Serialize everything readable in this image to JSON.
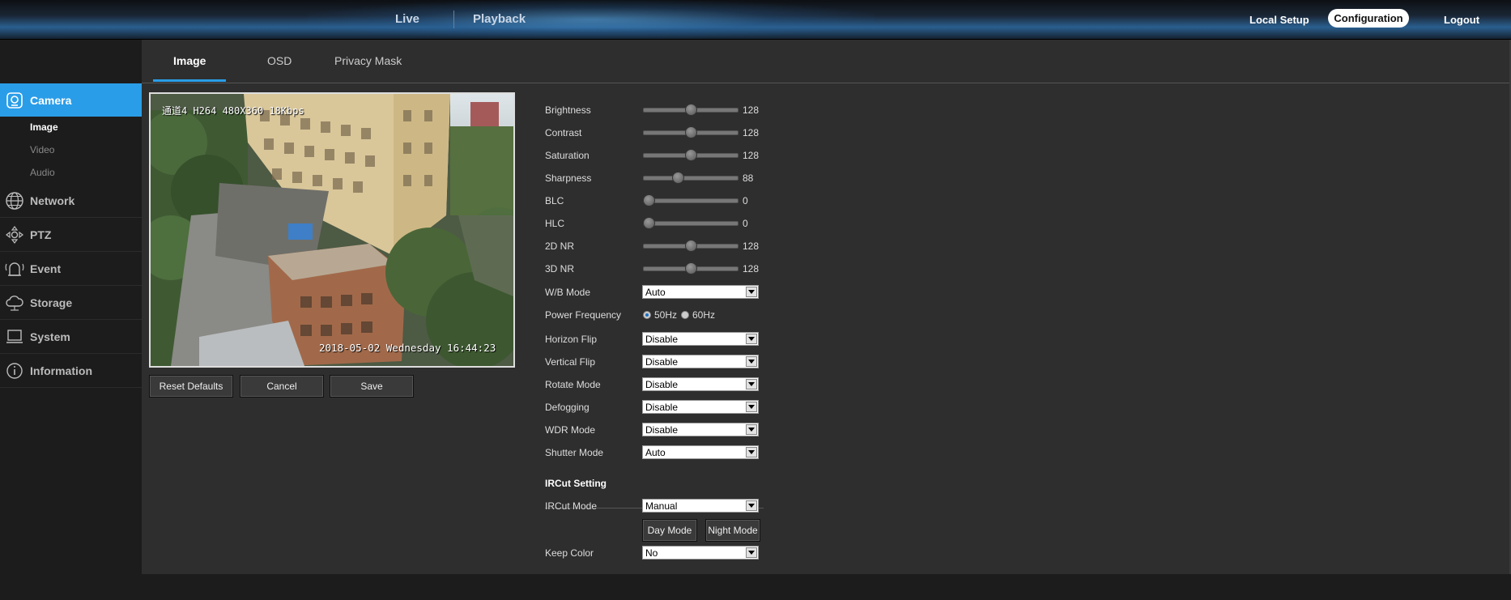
{
  "topnav": {
    "live": "Live",
    "playback": "Playback",
    "local_setup": "Local Setup",
    "configuration": "Configuration",
    "logout": "Logout"
  },
  "sidebar": {
    "items": [
      {
        "label": "Camera",
        "icon": "camera-icon",
        "active": true
      },
      {
        "label": "Network",
        "icon": "globe-icon"
      },
      {
        "label": "PTZ",
        "icon": "ptz-icon"
      },
      {
        "label": "Event",
        "icon": "alarm-icon"
      },
      {
        "label": "Storage",
        "icon": "cloud-icon"
      },
      {
        "label": "System",
        "icon": "monitor-icon"
      },
      {
        "label": "Information",
        "icon": "info-icon"
      }
    ],
    "camera_sub": [
      "Image",
      "Video",
      "Audio"
    ],
    "selected_sub": "Image"
  },
  "tabs": [
    "Image",
    "OSD",
    "Privacy Mask"
  ],
  "video": {
    "osd_top": "通道4 H264 480X360 18Kbps",
    "osd_bottom": "2018-05-02 Wednesday 16:44:23"
  },
  "buttons": {
    "reset": "Reset Defaults",
    "cancel": "Cancel",
    "save": "Save"
  },
  "sliders": [
    {
      "label": "Brightness",
      "value": "128",
      "fraction": 0.5
    },
    {
      "label": "Contrast",
      "value": "128",
      "fraction": 0.5
    },
    {
      "label": "Saturation",
      "value": "128",
      "fraction": 0.5
    },
    {
      "label": "Sharpness",
      "value": "88",
      "fraction": 0.345
    },
    {
      "label": "BLC",
      "value": "0",
      "fraction": 0.0
    },
    {
      "label": "HLC",
      "value": "0",
      "fraction": 0.0
    },
    {
      "label": "2D NR",
      "value": "128",
      "fraction": 0.5
    },
    {
      "label": "3D NR",
      "value": "128",
      "fraction": 0.5
    }
  ],
  "wb_mode": {
    "label": "W/B Mode",
    "value": "Auto"
  },
  "power_frequency": {
    "label": "Power Frequency",
    "options": [
      "50Hz",
      "60Hz"
    ],
    "selected": "50Hz"
  },
  "selects": [
    {
      "label": "Horizon Flip",
      "value": "Disable"
    },
    {
      "label": "Vertical Flip",
      "value": "Disable"
    },
    {
      "label": "Rotate Mode",
      "value": "Disable"
    },
    {
      "label": "Defogging",
      "value": "Disable"
    },
    {
      "label": "WDR Mode",
      "value": "Disable"
    },
    {
      "label": "Shutter Mode",
      "value": "Auto"
    }
  ],
  "ircut": {
    "title": "IRCut Setting",
    "mode_label": "IRCut Mode",
    "mode_value": "Manual",
    "day_button": "Day Mode",
    "night_button": "Night Mode",
    "keep_color_label": "Keep Color",
    "keep_color_value": "No"
  },
  "colors": {
    "accent": "#2a9de8",
    "panel": "#2e2e2e",
    "background": "#1c1c1c"
  }
}
